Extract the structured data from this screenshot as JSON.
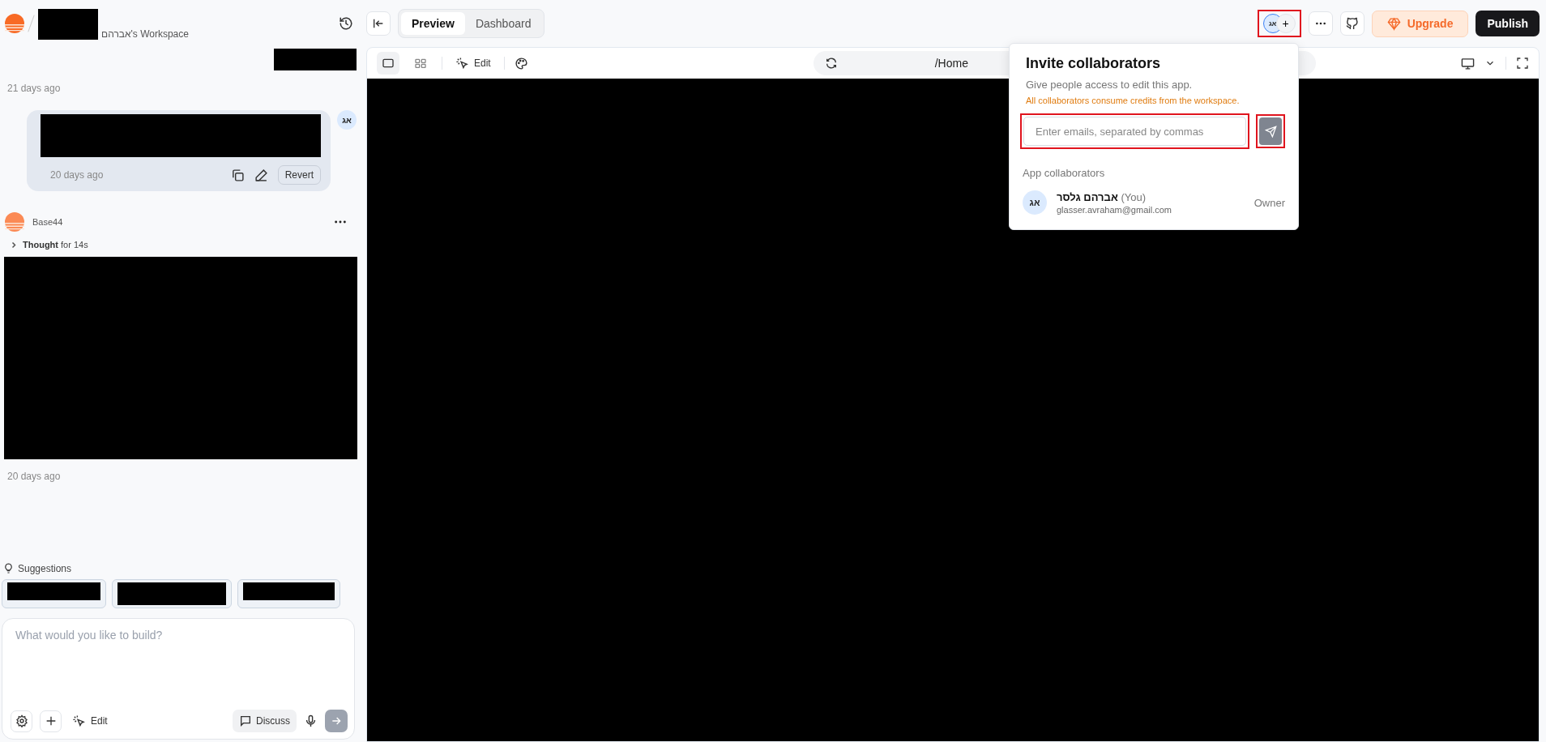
{
  "sidebar": {
    "workspace": "אברהם's Workspace",
    "messages": [
      {
        "kind": "time",
        "text": "21 days ago"
      },
      {
        "kind": "user",
        "avatar": "אג",
        "time": "20 days ago",
        "action": "Revert"
      },
      {
        "kind": "bot",
        "name": "Base44",
        "thought": "Thought",
        "duration": "for 14s",
        "time": "20 days ago"
      }
    ],
    "suggestions_label": "Suggestions",
    "composer": {
      "placeholder": "What would you like to build?",
      "edit": "Edit",
      "discuss": "Discuss",
      "send_disabled": true
    }
  },
  "topbar": {
    "tabs": [
      {
        "label": "Preview",
        "selected": true
      },
      {
        "label": "Dashboard",
        "selected": false
      }
    ],
    "avatar": "אג",
    "plus": "+",
    "upgrade": "Upgrade",
    "publish": "Publish"
  },
  "preview": {
    "views": [
      {
        "kind": "single",
        "selected": true
      },
      {
        "kind": "grid",
        "selected": false
      }
    ],
    "edit": "Edit",
    "path": "/Home"
  },
  "invite": {
    "title": "Invite collaborators",
    "subtitle": "Give people access to edit this app.",
    "warning": "All collaborators consume credits from the workspace.",
    "placeholder": "Enter emails, separated by commas",
    "send_disabled": true,
    "list_title": "App collaborators",
    "collaborators": [
      {
        "avatar": "אג",
        "name": "אברהם גלסר",
        "you": "(You)",
        "email": "glasser.avraham@gmail.com",
        "role": "Owner"
      }
    ]
  }
}
